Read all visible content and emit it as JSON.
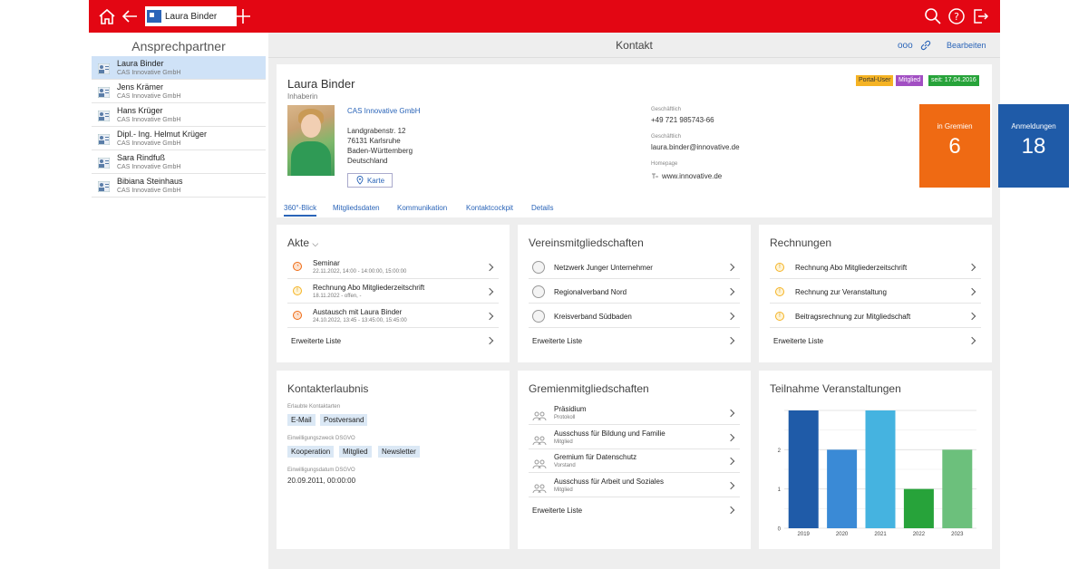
{
  "topbar": {
    "tab_label": "Laura Binder",
    "colors": {
      "bar": "#e30613"
    }
  },
  "sidebar": {
    "title": "Ansprechpartner",
    "items": [
      {
        "name": "Laura Binder",
        "company": "CAS Innovative GmbH",
        "selected": true
      },
      {
        "name": "Jens Krämer",
        "company": "CAS Innovative GmbH"
      },
      {
        "name": "Hans Krüger",
        "company": "CAS Innovative GmbH"
      },
      {
        "name": "Dipl.- Ing. Helmut Krüger",
        "company": "CAS Innovative GmbH"
      },
      {
        "name": "Sara Rindfuß",
        "company": "CAS Innovative GmbH"
      },
      {
        "name": "Bibiana Steinhaus",
        "company": "CAS Innovative GmbH"
      }
    ]
  },
  "header": {
    "title": "Kontakt",
    "more": "ooo",
    "edit": "Bearbeiten"
  },
  "profile": {
    "name": "Laura Binder",
    "role": "Inhaberin",
    "company": "CAS Innovative GmbH",
    "address": [
      "Landgrabenstr. 12",
      "76131 Karlsruhe",
      "Baden-Württemberg",
      "Deutschland"
    ],
    "map_button": "Karte",
    "phone_label": "Geschäftlich",
    "phone": "+49 721 985743-66",
    "email_label": "Geschäftlich",
    "email": "laura.binder@innovative.de",
    "homepage_label": "Homepage",
    "homepage": "www.innovative.de",
    "badges": [
      {
        "text": "Portal-User",
        "color": "#f5b324"
      },
      {
        "text": "Mitglied",
        "color": "#a24fc3"
      },
      {
        "text": "seit: 17.04.2016",
        "color": "#27a33a"
      }
    ],
    "stats": [
      {
        "label": "in Gremien",
        "value": "6",
        "color": "#ef6a13"
      },
      {
        "label": "Anmeldungen",
        "value": "18",
        "color": "#1f5ba8"
      }
    ]
  },
  "tabs": [
    "360°-Blick",
    "Mitgliedsdaten",
    "Kommunikation",
    "Kontaktcockpit",
    "Details"
  ],
  "akte": {
    "title": "Akte",
    "rows": [
      {
        "title": "Seminar",
        "sub": "22.11.2022, 14:00 - 14:00:00, 15:00:00",
        "icon": "event-icon"
      },
      {
        "title": "Rechnung Abo Mitgliederzeitschrift",
        "sub": "18.11.2022 - offen, -",
        "icon": "invoice-icon"
      },
      {
        "title": "Austausch mit Laura Binder",
        "sub": "24.10.2022, 13:45 - 13:45:00, 15:45:00",
        "icon": "event-icon"
      }
    ],
    "more": "Erweiterte Liste"
  },
  "vereine": {
    "title": "Vereinsmitgliedschaften",
    "rows": [
      "Netzwerk Junger Unternehmer",
      "Regionalverband Nord",
      "Kreisverband Südbaden"
    ],
    "more": "Erweiterte Liste"
  },
  "rechnungen": {
    "title": "Rechnungen",
    "rows": [
      "Rechnung Abo Mitgliederzeitschrift",
      "Rechnung zur Veranstaltung",
      "Beitragsrechnung zur Mitgliedschaft"
    ],
    "more": "Erweiterte Liste"
  },
  "erlaubnis": {
    "title": "Kontakterlaubnis",
    "types_label": "Erlaubte Kontaktarten",
    "types": [
      "E-Mail",
      "Postversand"
    ],
    "purpose_label": "Einwilligungszweck DSGVO",
    "purposes": [
      "Kooperation",
      "Mitglied",
      "Newsletter"
    ],
    "date_label": "Einwilligungsdatum DSGVO",
    "date": "20.09.2011, 00:00:00"
  },
  "gremien": {
    "title": "Gremienmitgliedschaften",
    "rows": [
      {
        "title": "Präsidium",
        "sub": "Protokoll"
      },
      {
        "title": "Ausschuss für Bildung und Familie",
        "sub": "Mitglied"
      },
      {
        "title": "Gremium für Datenschutz",
        "sub": "Vorstand"
      },
      {
        "title": "Ausschuss für Arbeit und Soziales",
        "sub": "Mitglied"
      }
    ],
    "more": "Erweiterte Liste"
  },
  "chart_data": {
    "type": "bar",
    "title": "Teilnahme Veranstaltungen",
    "categories": [
      "2019",
      "2020",
      "2021",
      "2022",
      "2023"
    ],
    "values": [
      3,
      2,
      3,
      1,
      2
    ],
    "colors": [
      "#1f5ba8",
      "#3a8ad6",
      "#45b3e0",
      "#27a33a",
      "#6cc07c"
    ],
    "yticks": [
      "0",
      "1",
      "2"
    ],
    "ylim": [
      0,
      3
    ],
    "grid": true
  }
}
